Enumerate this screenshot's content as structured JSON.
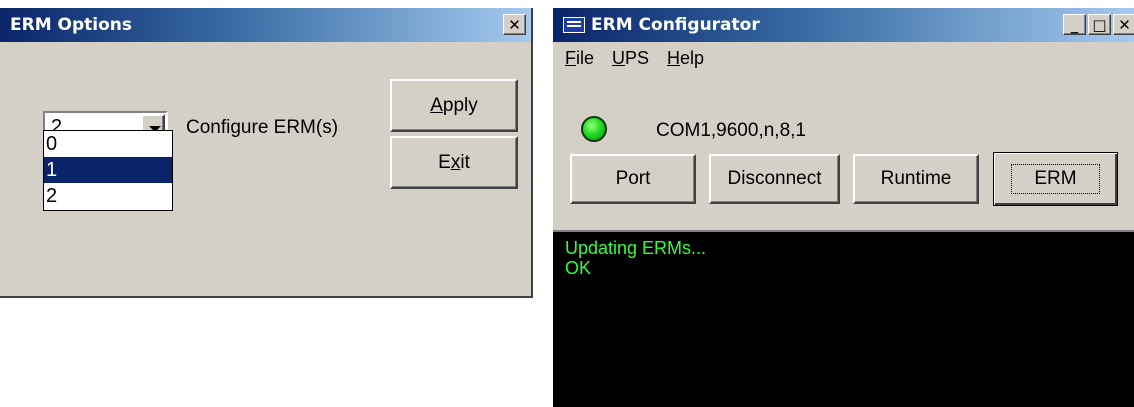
{
  "erm_options": {
    "title": "ERM Options",
    "close_glyph": "✕",
    "combo_value": "2",
    "dropdown_options": [
      "0",
      "1",
      "2"
    ],
    "selected_option_index": 1,
    "configure_label": "Configure ERM(s)",
    "apply_button": {
      "mnemonic": "A",
      "rest": "pply"
    },
    "exit_button": {
      "pre": "E",
      "mnemonic": "x",
      "post": "it"
    }
  },
  "erm_configurator": {
    "title": "ERM Configurator",
    "window_controls": {
      "minimize": "_",
      "maximize": "□",
      "close": "✕"
    },
    "menu": [
      {
        "mnemonic": "F",
        "rest": "ile"
      },
      {
        "mnemonic": "U",
        "rest": "PS"
      },
      {
        "mnemonic": "H",
        "rest": "elp"
      }
    ],
    "status_led_color": "#22dd22",
    "port_info": "COM1,9600,n,8,1",
    "buttons": {
      "port": "Port",
      "disconnect": "Disconnect",
      "runtime": "Runtime",
      "erm": "ERM"
    },
    "console_lines": [
      "Updating ERMs...",
      "OK"
    ],
    "console_text_color": "#33ff33"
  }
}
